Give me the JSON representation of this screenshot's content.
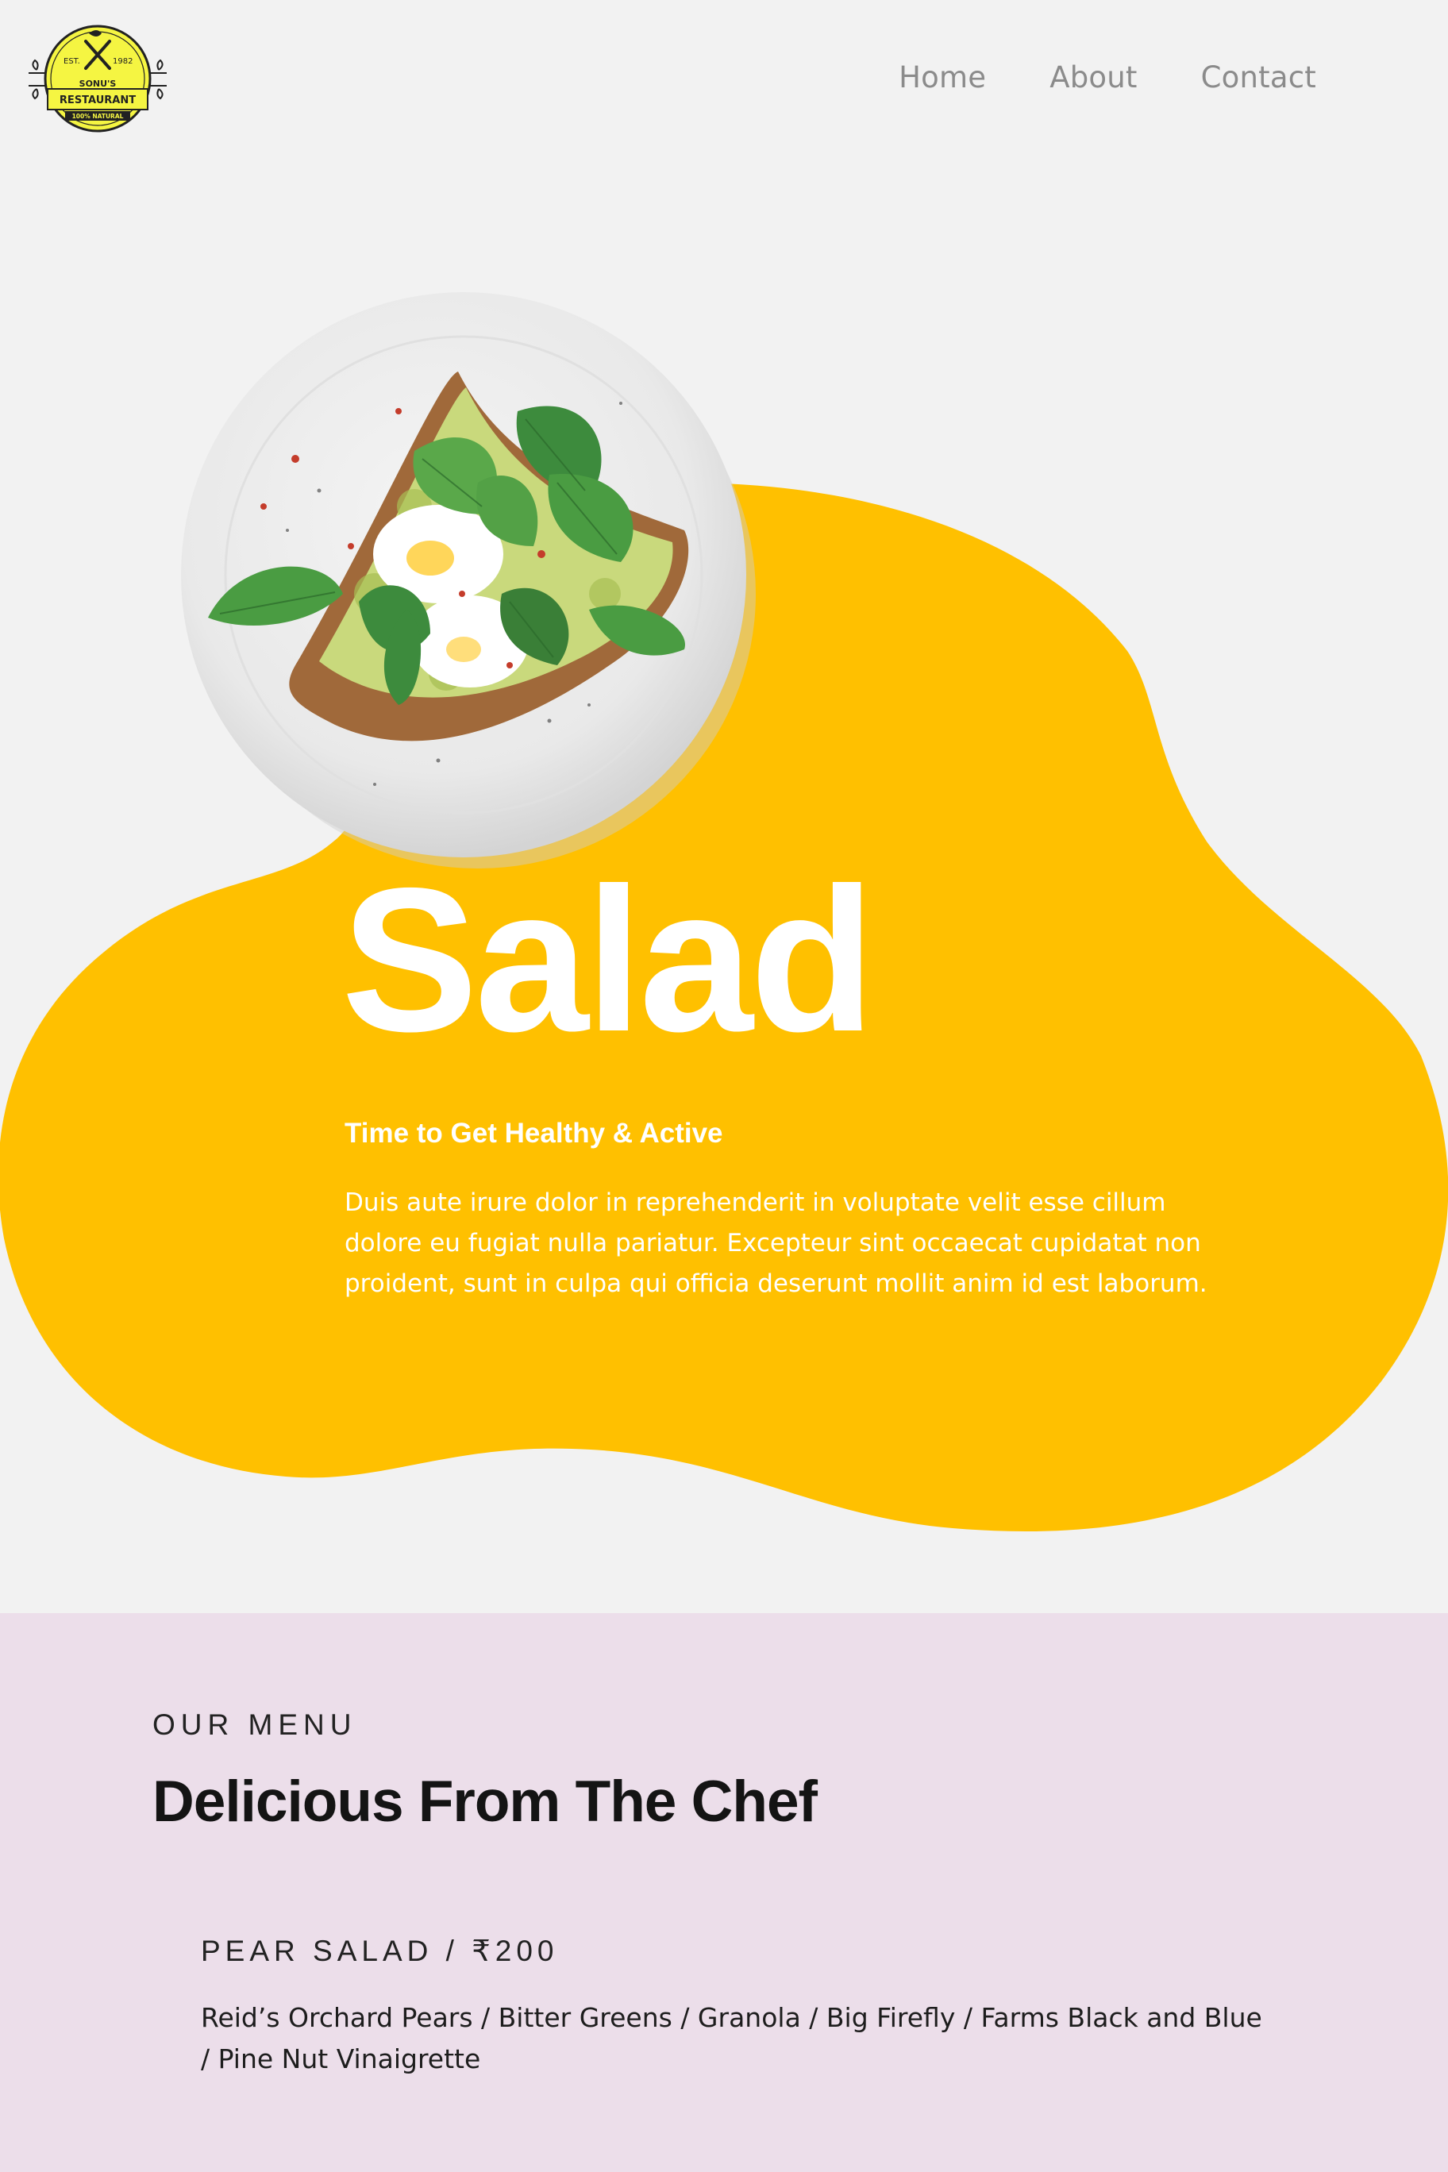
{
  "logo": {
    "est": "EST.",
    "year": "1982",
    "name_line1": "SONU'S",
    "name_line2": "RESTAURANT",
    "tagline": "100% NATURAL"
  },
  "nav": {
    "items": [
      {
        "label": "Home"
      },
      {
        "label": "About"
      },
      {
        "label": "Contact"
      }
    ]
  },
  "hero": {
    "title": "Salad",
    "subtitle": "Time to Get Healthy & Active",
    "body": "Duis aute irure dolor in reprehenderit in voluptate velit esse cillum dolore eu fugiat nulla pariatur. Excepteur sint occaecat cupidatat non proident, sunt in culpa qui officia deserunt mollit anim id est laborum.",
    "image": "salad-plate-image"
  },
  "menu": {
    "eyebrow": "OUR MENU",
    "heading": "Delicious From The Chef",
    "items": [
      {
        "title": "PEAR SALAD / ₹200",
        "description": "Reid’s Orchard Pears / Bitter Greens / Granola / Big Firefly / Farms Black and Blue / Pine Nut Vinaigrette"
      }
    ]
  },
  "colors": {
    "background": "#f2f2f2",
    "accent_yellow": "#ffc000",
    "menu_background": "#ecdeea",
    "nav_text": "#8b8b8b",
    "logo_yellow": "#f5f542"
  }
}
